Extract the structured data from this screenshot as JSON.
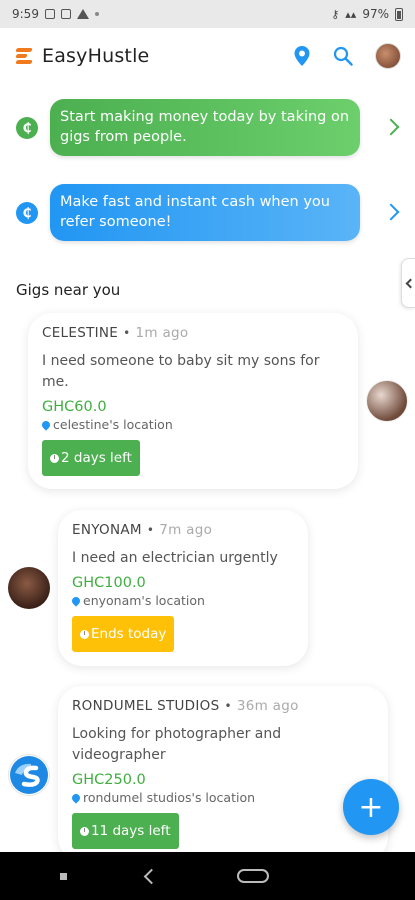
{
  "status_bar": {
    "time": "9:59",
    "battery": "97%"
  },
  "app": {
    "title": "EasyHustle",
    "icons": [
      "location-pin-icon",
      "search-icon",
      "profile-avatar"
    ]
  },
  "banners": [
    {
      "text": "Start making money today by taking on gigs from people.",
      "color": "#4caf50",
      "icon": "cedi-icon"
    },
    {
      "text": "Make fast and instant cash when you refer someone!",
      "color": "#2196f3",
      "icon": "cedi-icon"
    }
  ],
  "section": {
    "title": "Gigs near you"
  },
  "gigs": [
    {
      "poster": "CELESTINE",
      "time": "1m ago",
      "description": "I need someone to baby sit my sons for me.",
      "price": "GHC60.0",
      "location": "celestine's location",
      "badge": "2 days left",
      "badge_color": "#4caf50"
    },
    {
      "poster": "ENYONAM",
      "time": "7m ago",
      "description": "I need an electrician urgently",
      "price": "GHC100.0",
      "location": "enyonam's location",
      "badge": "Ends today",
      "badge_color": "#ffc107"
    },
    {
      "poster": "RONDUMEL STUDIOS",
      "time": "36m ago",
      "description": "Looking for photographer and videographer",
      "price": "GHC250.0",
      "location": "rondumel studios's location",
      "badge": "11 days left",
      "badge_color": "#4caf50"
    }
  ],
  "colors": {
    "accent_blue": "#2196f3",
    "accent_green": "#4caf50",
    "accent_orange": "#f07a1c",
    "accent_yellow": "#ffc107"
  },
  "fab": {
    "label": "+"
  }
}
